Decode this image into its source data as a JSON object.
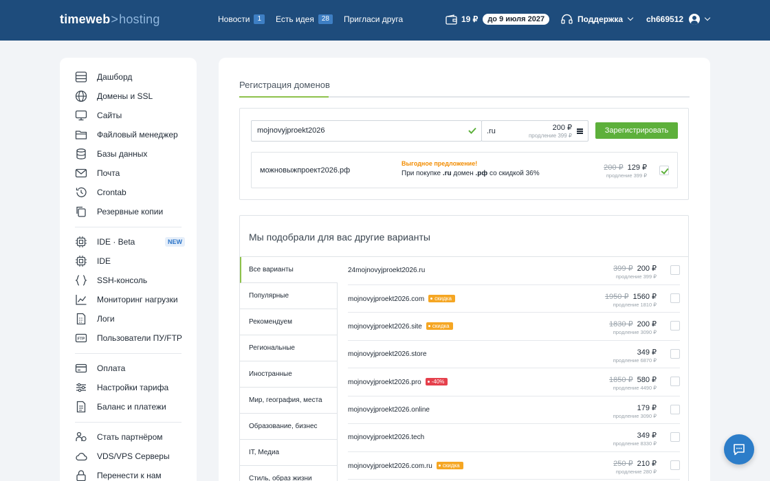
{
  "header": {
    "logo_main": "timeweb",
    "logo_sep": ">",
    "logo_sub": "hosting",
    "nav": [
      {
        "label": "Новости",
        "badge": "1"
      },
      {
        "label": "Есть идея",
        "badge": "28"
      },
      {
        "label": "Пригласи друга",
        "badge": ""
      }
    ],
    "balance": "19 ₽",
    "balance_until": "до 9 июля 2027",
    "support": "Поддержка",
    "username": "ch669512"
  },
  "sidebar": {
    "items": [
      {
        "label": "Дашборд",
        "icon": "dashboard-icon"
      },
      {
        "label": "Домены и SSL",
        "icon": "globe-icon"
      },
      {
        "label": "Сайты",
        "icon": "monitor-icon"
      },
      {
        "label": "Файловый менеджер",
        "icon": "folder-icon"
      },
      {
        "label": "Базы данных",
        "icon": "database-icon"
      },
      {
        "label": "Почта",
        "icon": "mail-icon"
      },
      {
        "label": "Crontab",
        "icon": "history-icon"
      },
      {
        "label": "Резервные копии",
        "icon": "copy-icon"
      },
      {
        "label": "IDE · Beta",
        "icon": "chip-icon",
        "badge": "NEW"
      },
      {
        "label": "IDE",
        "icon": "chip-icon"
      },
      {
        "label": "SSH-консоль",
        "icon": "braces-icon"
      },
      {
        "label": "Мониторинг нагрузки",
        "icon": "chart-icon"
      },
      {
        "label": "Логи",
        "icon": "log-icon"
      },
      {
        "label": "Пользователи ПУ/FTP",
        "icon": "ftp-icon"
      },
      {
        "label": "Оплата",
        "icon": "card-icon"
      },
      {
        "label": "Настройки тарифа",
        "icon": "sliders-icon"
      },
      {
        "label": "Баланс и платежи",
        "icon": "document-icon"
      },
      {
        "label": "Стать партнёром",
        "icon": "partner-icon"
      },
      {
        "label": "VDS/VPS Серверы",
        "icon": "cloud-icon"
      },
      {
        "label": "Перенести к нам",
        "icon": "lock-icon"
      }
    ]
  },
  "main": {
    "tab": "Регистрация доменов",
    "domain_value": "mojnovyjproekt2026",
    "zone": ".ru",
    "zone_price": "200 ₽",
    "zone_renew": "продление 399 ₽",
    "register_label": "Зарегистрировать",
    "offer": {
      "domain": "можновыжпроект2026.рф",
      "headline": "Выгодное предложение!",
      "text_1": "При покупке",
      "text_zone1": ".ru",
      "text_2": "домен",
      "text_zone2": ".рф",
      "text_3": "со скидкой 36%",
      "old_price": "200 ₽",
      "price": "129 ₽",
      "renew": "продление 399 ₽",
      "checked": true
    },
    "suggest_title": "Мы подобрали для вас другие варианты",
    "categories": [
      "Все варианты",
      "Популярные",
      "Рекомендуем",
      "Региональные",
      "Иностранные",
      "Мир, география, места",
      "Образование, бизнес",
      "IT, Медиа",
      "Стиль, образ жизни"
    ],
    "domains": [
      {
        "name": "24mojnovyjproekt2026.ru",
        "tag": "",
        "old": "399 ₽",
        "price": "200 ₽",
        "renew": "продление 399 ₽"
      },
      {
        "name": "mojnovyjproekt2026.com",
        "tag": "скидка",
        "old": "1950 ₽",
        "price": "1560 ₽",
        "renew": "продление 1810 ₽"
      },
      {
        "name": "mojnovyjproekt2026.site",
        "tag": "скидка",
        "old": "1830 ₽",
        "price": "200 ₽",
        "renew": "продление 3090 ₽"
      },
      {
        "name": "mojnovyjproekt2026.store",
        "tag": "",
        "old": "",
        "price": "349 ₽",
        "renew": "продление 6870 ₽"
      },
      {
        "name": "mojnovyjproekt2026.pro",
        "tag": "-40%",
        "old": "1850 ₽",
        "price": "580 ₽",
        "renew": "продление 4490 ₽"
      },
      {
        "name": "mojnovyjproekt2026.online",
        "tag": "",
        "old": "",
        "price": "179 ₽",
        "renew": "продление 3090 ₽"
      },
      {
        "name": "mojnovyjproekt2026.tech",
        "tag": "",
        "old": "",
        "price": "349 ₽",
        "renew": "продление 8330 ₽"
      },
      {
        "name": "mojnovyjproekt2026.com.ru",
        "tag": "скидка",
        "old": "250 ₽",
        "price": "210 ₽",
        "renew": "продление 280 ₽"
      }
    ]
  },
  "colors": {
    "header_bg": "#1e4c7c",
    "accent_green": "#5db03b",
    "tag_orange": "#f5a623",
    "tag_red": "#e5404c",
    "chat_blue": "#2c7dc9"
  }
}
